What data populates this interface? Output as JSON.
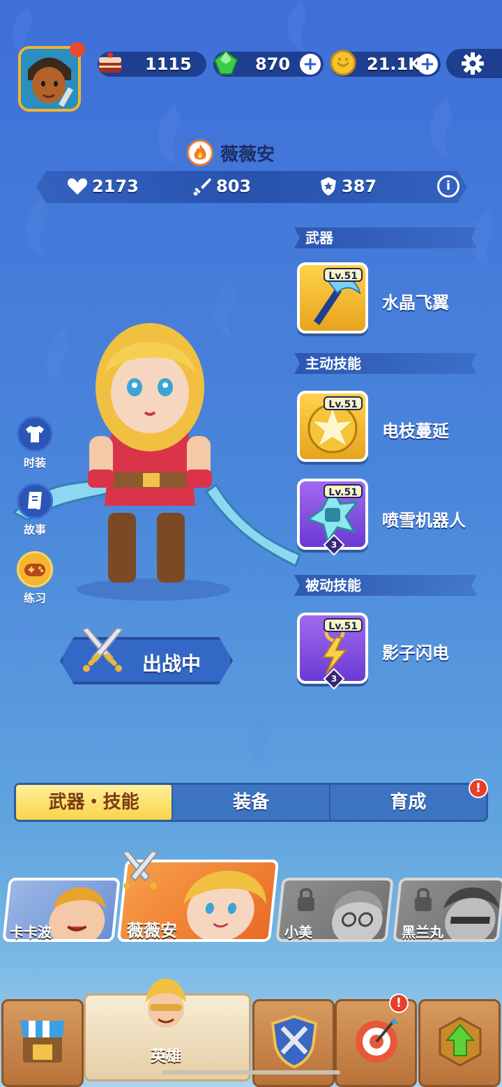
{
  "resources": {
    "cake": "1115",
    "gems": "870",
    "coins": "21.1K"
  },
  "hero": {
    "name": "薇薇安",
    "health": "2173",
    "attack": "803",
    "defense": "387"
  },
  "sections": {
    "weapon": "武器",
    "active_skill": "主动技能",
    "passive_skill": "被动技能"
  },
  "items": {
    "weapon": {
      "level": "Lv.51",
      "name": "水晶飞翼"
    },
    "active1": {
      "level": "Lv.51",
      "name": "电枝蔓延"
    },
    "active2": {
      "level": "Lv.51",
      "name": "喷雪机器人",
      "rank": "3"
    },
    "passive1": {
      "level": "Lv.51",
      "name": "影子闪电",
      "rank": "3"
    }
  },
  "side": {
    "costume": "时装",
    "story": "故事",
    "practice": "练习"
  },
  "battle_status": "出战中",
  "tabs": [
    "武器・技能",
    "装备",
    "育成"
  ],
  "heroes": [
    "卡卡波",
    "薇薇安",
    "小美",
    "黑兰丸"
  ],
  "nav": {
    "hero_label": "英雄"
  },
  "alerts": {
    "mark": "!"
  }
}
